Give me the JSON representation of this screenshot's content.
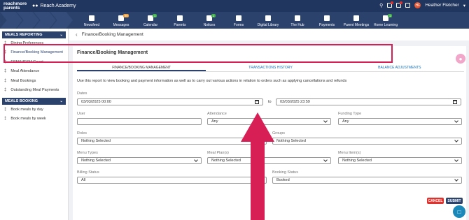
{
  "app": {
    "brand": "reachmore parents",
    "school": "Reach Academy",
    "user": "Heather Fletcher",
    "avatar_initial": "HF"
  },
  "nav": [
    {
      "label": "Newsfeed",
      "icon": "newspaper-icon",
      "badge": ""
    },
    {
      "label": "Messages",
      "icon": "envelope-icon",
      "badge": "99"
    },
    {
      "label": "Calendar",
      "icon": "calendar-icon",
      "badge": "1"
    },
    {
      "label": "Parents",
      "icon": "parents-icon",
      "badge": ""
    },
    {
      "label": "Notices",
      "icon": "notices-icon",
      "badge": "1"
    },
    {
      "label": "Forms",
      "icon": "form-icon",
      "badge": ""
    },
    {
      "label": "Digital Library",
      "icon": "library-icon",
      "badge": ""
    },
    {
      "label": "The Hub",
      "icon": "hub-icon",
      "badge": ""
    },
    {
      "label": "Payments",
      "icon": "cart-icon",
      "badge": ""
    },
    {
      "label": "Parent Meetings",
      "icon": "meetings-icon",
      "badge": ""
    },
    {
      "label": "Home Learning",
      "icon": "home-learning-icon",
      "badge": "1"
    }
  ],
  "sidebar": {
    "section1": "MEALS REPORTING",
    "items1": [
      "Dining Preferences",
      "Finance/Booking Management",
      "FSM/UIFSM Count",
      "Meal Attendance",
      "Meal Bookings",
      "Outstanding Meal Payments"
    ],
    "section2": "MEALS BOOKING",
    "items2": [
      "Book meals by day",
      "Book meals by week"
    ]
  },
  "breadcrumb": "Finance/Booking Management",
  "page_title": "Finance/Booking Management",
  "tabs": [
    "FINANCE/BOOKING MANAGEMENT",
    "TRANSACTIONS HISTORY",
    "BALANCE ADJUSTMENTS"
  ],
  "description": "Use this report to view booking and payment information as well as to carry out various actions in relation to orders such as applying cancellations and refunds",
  "form": {
    "dates_label": "Dates",
    "date_from": "03/03/2025 00:00",
    "to_label": "to",
    "date_to": "03/03/2025 23:59",
    "user_label": "User",
    "user_value": "",
    "attendance_label": "Attendance",
    "attendance_value": "Any",
    "funding_label": "Funding Type",
    "funding_value": "Any",
    "roles_label": "Roles",
    "roles_value": "Nothing Selected",
    "groups_label": "Groups",
    "groups_value": "Nothing Selected",
    "menu_types_label": "Menu Types",
    "menu_types_value": "Nothing Selected",
    "meal_plans_label": "Meal Plan(s)",
    "meal_plans_value": "Nothing Selected",
    "menu_items_label": "Menu Item(s)",
    "menu_items_value": "Nothing Selected",
    "billing_label": "Billing Status",
    "billing_value": "All",
    "booking_label": "Booking Status",
    "booking_value": "Booked"
  },
  "buttons": {
    "cancel": "CANCEL",
    "submit": "SUBMIT"
  },
  "colors": {
    "header": "#21365f",
    "nav": "#2b426d",
    "highlight": "#d81f55",
    "cancel": "#e0312d",
    "submit": "#2b426d"
  }
}
